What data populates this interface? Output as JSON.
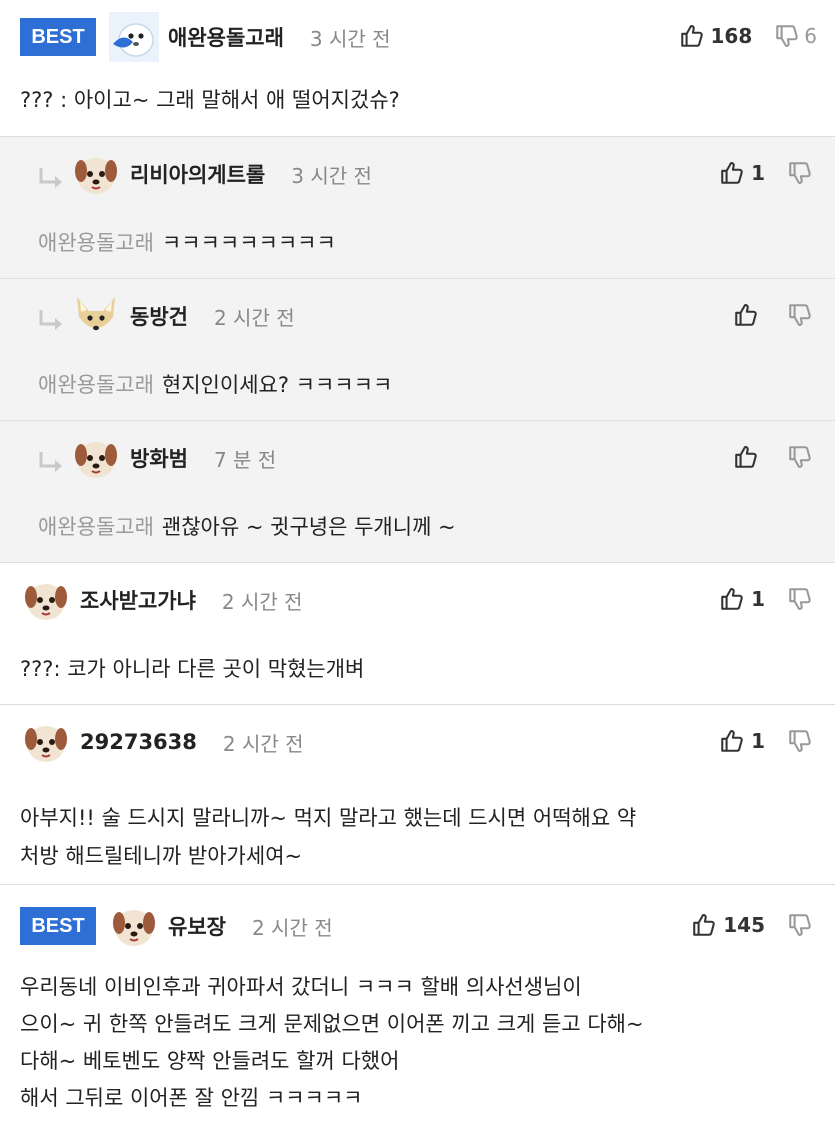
{
  "comments": [
    {
      "best": "BEST",
      "nick": "애완용돌고래",
      "time": "3 시간 전",
      "likes": "168",
      "dislikes": "6",
      "text": "??? : 아이고~ 그래 말해서 애 떨어지겄슈?"
    },
    {
      "nick": "리비아의게트롤",
      "time": "3 시간 전",
      "likes": "1",
      "dislikes": "",
      "mention": "애완용돌고래",
      "text": "ㅋㅋㅋㅋㅋㅋㅋㅋㅋ"
    },
    {
      "nick": "동방건",
      "time": "2 시간 전",
      "likes": "",
      "dislikes": "",
      "mention": "애완용돌고래",
      "text": "현지인이세요? ㅋㅋㅋㅋㅋ"
    },
    {
      "nick": "방화범",
      "time": "7 분 전",
      "likes": "",
      "dislikes": "",
      "mention": "애완용돌고래",
      "text": "괜찮아유 ~ 귓구녕은 두개니께 ~"
    },
    {
      "nick": "조사받고가냐",
      "time": "2 시간 전",
      "likes": "1",
      "dislikes": "",
      "text": "???: 코가 아니라 다른 곳이 막혔는개벼"
    },
    {
      "nick": "29273638",
      "time": "2 시간 전",
      "likes": "1",
      "dislikes": "",
      "text_lines": [
        "아부지!! 술 드시지 말라니까~ 먹지 말라고 했는데 드시면 어떡해요 약",
        "처방 해드릴테니까 받아가세여~"
      ]
    },
    {
      "best": "BEST",
      "nick": "유보장",
      "time": "2 시간 전",
      "likes": "145",
      "dislikes": "",
      "text_lines": [
        "우리동네 이비인후과 귀아파서 갔더니 ㅋㅋㅋ 할배 의사선생님이",
        "으이~ 귀 한쪽 안들려도 크게 문제없으면 이어폰 끼고 크게 듣고 다해~",
        "다해~ 베토벤도 양짝 안들려도 할꺼 다했어",
        "해서 그뒤로 이어폰 잘 안낌 ㅋㅋㅋㅋㅋ"
      ]
    }
  ],
  "icons": {
    "like": "thumbs-up-icon",
    "dislike": "thumbs-down-icon",
    "reply": "reply-arrow-icon",
    "avatar_accent": "#2e6fd6"
  }
}
